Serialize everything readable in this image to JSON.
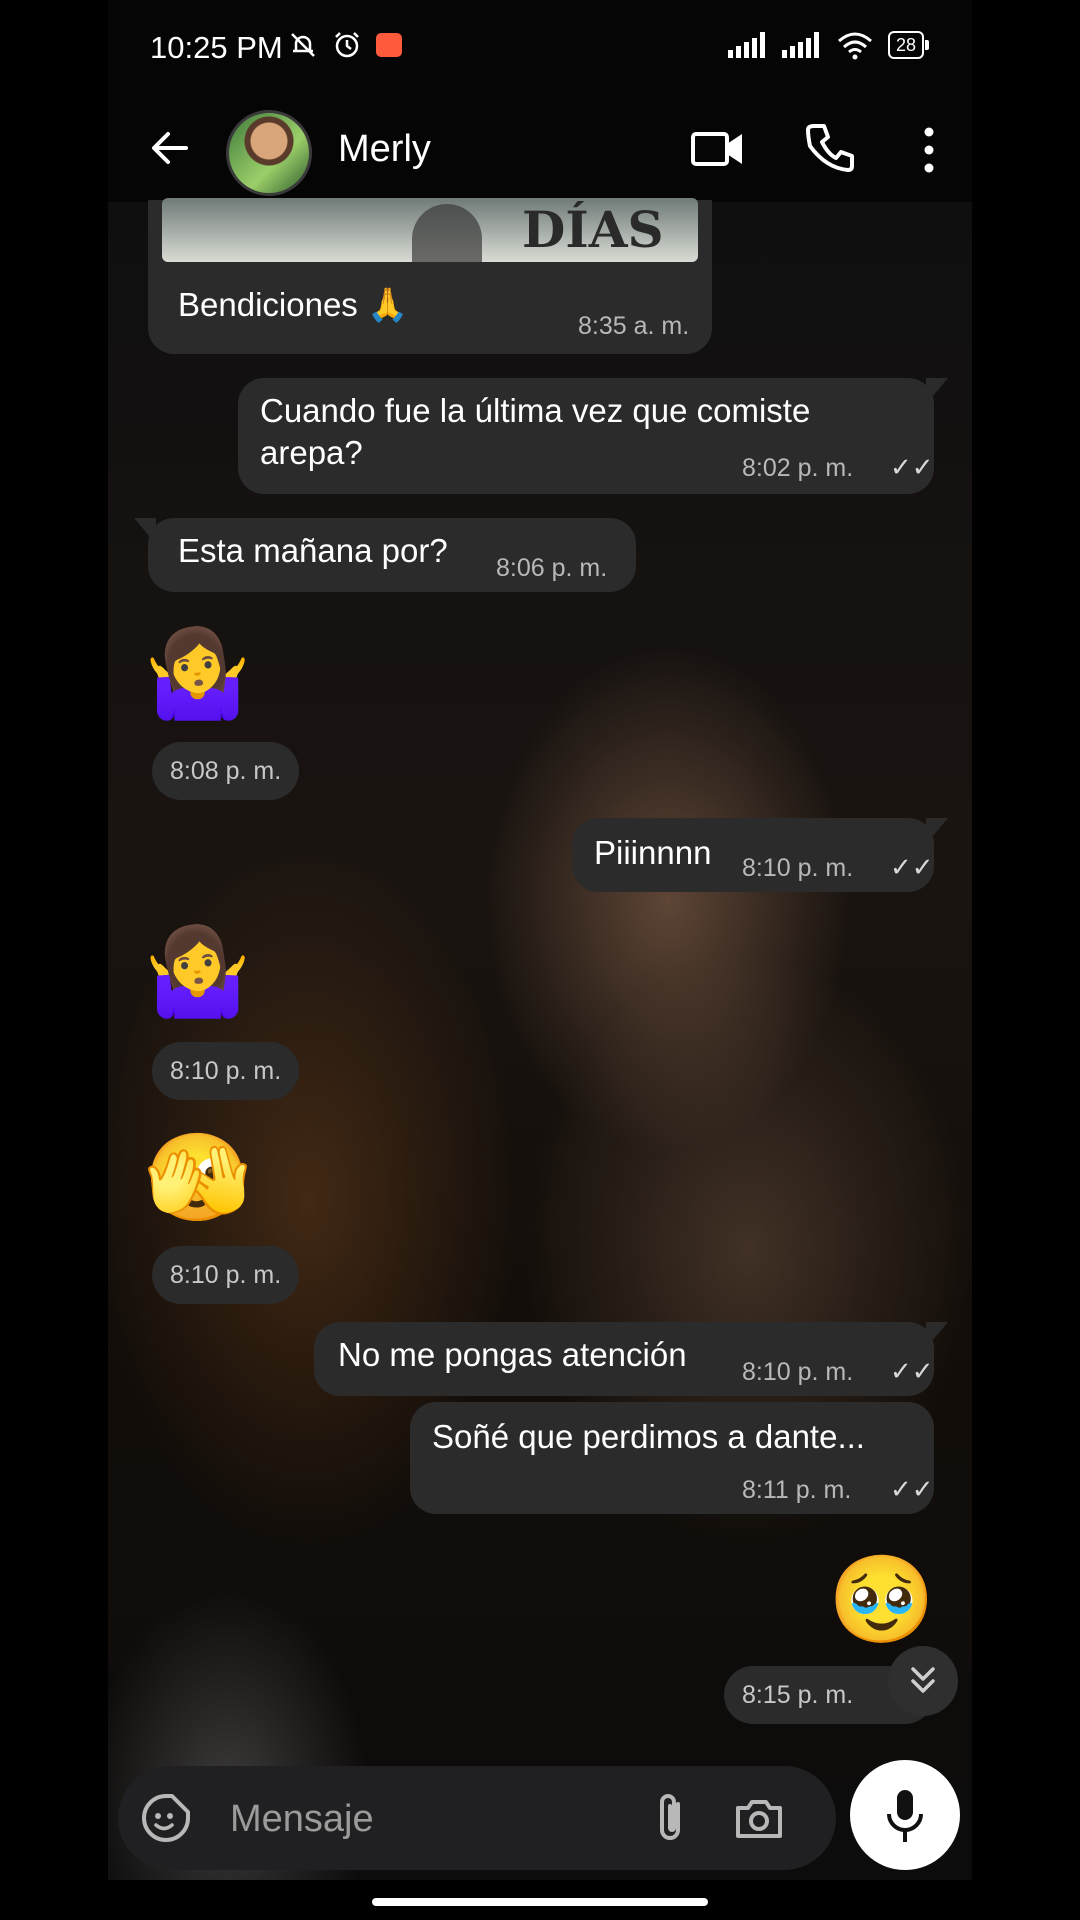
{
  "status_bar": {
    "time": "10:25 PM",
    "battery": "28"
  },
  "header": {
    "contact_name": "Merly"
  },
  "messages": [
    {
      "type": "in_image_caption",
      "image_text": "DÍAS",
      "text": "Bendiciones 🙏",
      "time": "8:35 a. m."
    },
    {
      "type": "out",
      "text_line1": "Cuando fue la última vez que comiste",
      "text_line2": "arepa?",
      "time": "8:02 p. m.",
      "ticks": "✓✓"
    },
    {
      "type": "in",
      "text": "Esta mañana por?",
      "time": "8:06 p. m."
    },
    {
      "type": "in_emoji",
      "emoji": "🤷‍♀️",
      "time": "8:08 p. m."
    },
    {
      "type": "out",
      "text": "Piiinnnn",
      "time": "8:10 p. m.",
      "ticks": "✓✓"
    },
    {
      "type": "in_emoji",
      "emoji": "🤷‍♀️",
      "time": "8:10 p. m."
    },
    {
      "type": "in_emoji",
      "emoji": "🫣",
      "time": "8:10 p. m."
    },
    {
      "type": "out",
      "text": "No me pongas atención",
      "time": "8:10 p. m.",
      "ticks": "✓✓"
    },
    {
      "type": "out",
      "text": "Soñé que perdimos a dante...",
      "time": "8:11 p. m.",
      "ticks": "✓✓"
    },
    {
      "type": "out_emoji",
      "emoji": "🥹",
      "time": "8:15 p. m."
    }
  ],
  "composer": {
    "placeholder": "Mensaje"
  },
  "icons": {
    "back": "arrow-left",
    "video": "video-camera",
    "call": "phone",
    "more": "three-dots-vertical",
    "sticker": "sticker-smiley",
    "attach": "paperclip",
    "camera": "camera",
    "mic": "microphone",
    "scroll_down": "double-chevron-down"
  },
  "colors": {
    "bubble": "#2b2b2b",
    "header_bg": "#050505",
    "composer_bg": "#202022",
    "mic_button": "#ffffff"
  }
}
